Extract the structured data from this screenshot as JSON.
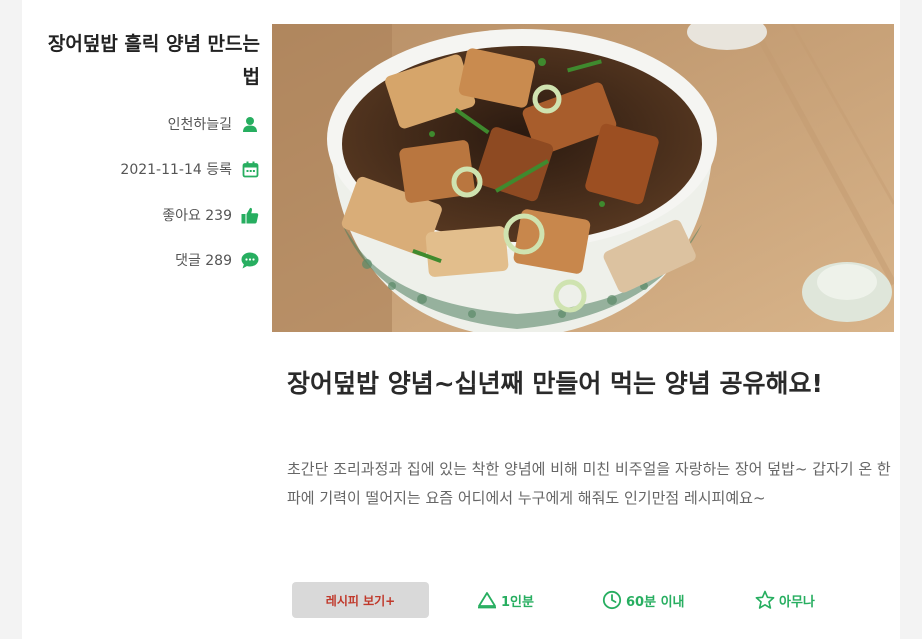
{
  "side": {
    "title": "장어덮밥 흘릭 양념 만드는 법",
    "author": "인천하늘길",
    "date": "2021-11-14 등록",
    "likes": "좋아요 239",
    "comments": "댓글 289"
  },
  "post": {
    "headline": "장어덮밥 양념~십년째 만들어 먹는 양념 공유해요!",
    "description": "초간단 조리과정과 집에 있는 착한 양념에 비해 미친 비주얼을 자랑하는 장어 덮밥~ 갑자기 온 한파에 기력이 떨어지는 요즘 어디에서 누구에게 해줘도 인기만점 레시피예요~"
  },
  "actions": {
    "recipe_button": "레시피 보기+",
    "serving": "1인분",
    "time": "60분 이내",
    "difficulty": "아무나"
  },
  "colors": {
    "accent": "#27ae60",
    "button_text": "#c0392b",
    "button_bg": "#d9d9d9"
  },
  "icons": [
    "user-icon",
    "calendar-icon",
    "thumbs-up-icon",
    "comment-icon",
    "serving-icon",
    "clock-icon",
    "star-icon"
  ]
}
